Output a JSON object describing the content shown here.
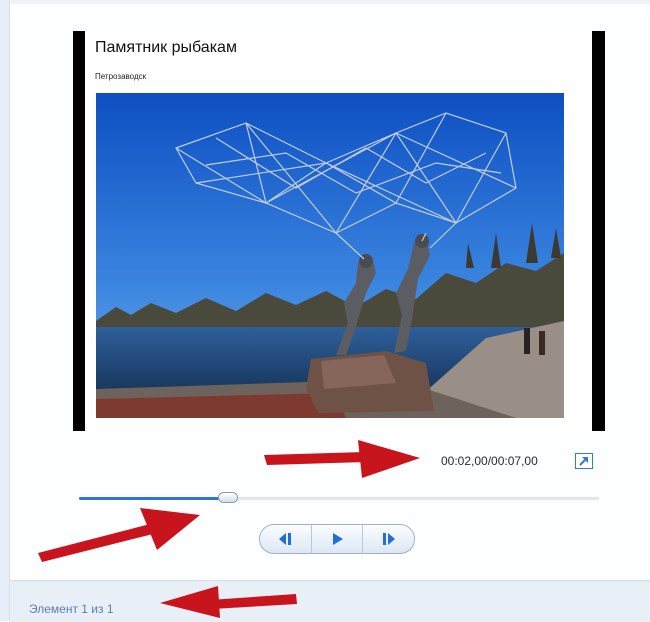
{
  "slide": {
    "title": "Памятник рыбакам",
    "subtitle": "Петрозаводск",
    "photo": "fishermen-monument-sculpture"
  },
  "player": {
    "time_readout": "00:02,00/00:07,00",
    "progress": 0.286,
    "buttons": [
      "previous-frame-icon",
      "play-icon",
      "next-frame-icon"
    ]
  },
  "status": {
    "text": "Элемент 1 из 1"
  },
  "colors": {
    "accent": "#2f74d8",
    "status_text": "#5a7db3",
    "annotation_arrow": "#c8141c"
  }
}
